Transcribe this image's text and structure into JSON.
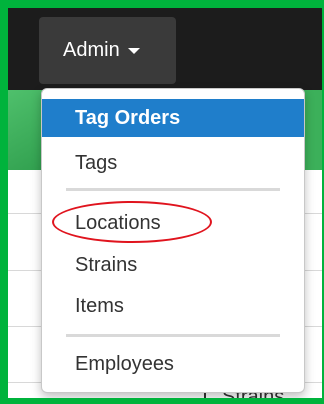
{
  "navbar": {
    "admin_label": "Admin",
    "admin_caret_icon": "caret-down-icon"
  },
  "dropdown": {
    "items": [
      {
        "label": "Tag Orders",
        "active": true
      },
      {
        "label": "Tags",
        "active": false
      },
      {
        "label": "Locations",
        "active": false,
        "highlighted": true
      },
      {
        "label": "Strains",
        "active": false
      },
      {
        "label": "Items",
        "active": false
      },
      {
        "label": "Employees",
        "active": false
      }
    ]
  },
  "background": {
    "peek_text": "Strains"
  },
  "colors": {
    "outer_border": "#00b33c",
    "navbar": "#1c1c1c",
    "admin_button": "#3a3a3a",
    "active_item": "#1f7ecb",
    "green_band": "#3cb05a",
    "annotation_ellipse": "#e0141e"
  }
}
